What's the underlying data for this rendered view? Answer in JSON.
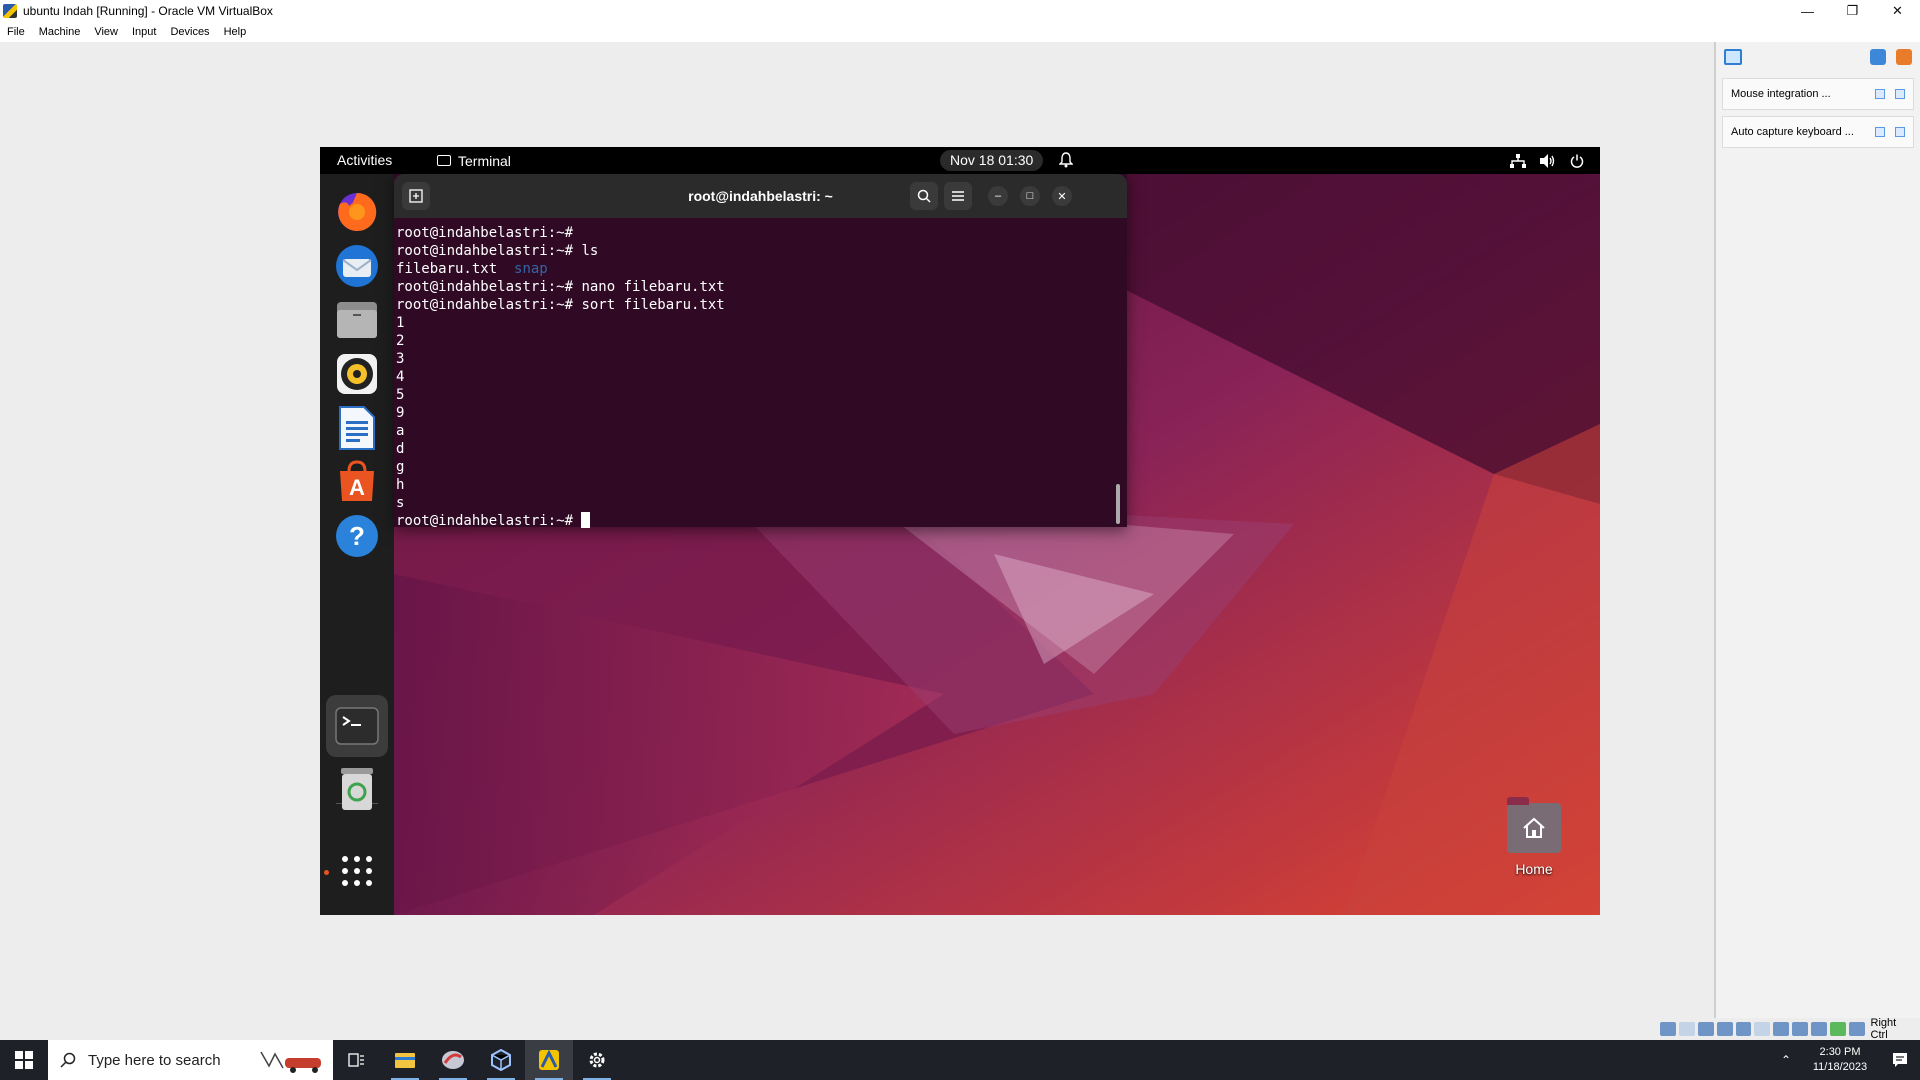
{
  "host_window": {
    "title": "ubuntu Indah [Running] - Oracle VM VirtualBox",
    "menu": [
      "File",
      "Machine",
      "View",
      "Input",
      "Devices",
      "Help"
    ]
  },
  "notifications": [
    {
      "text": "Mouse integration ..."
    },
    {
      "text": "Auto capture keyboard ..."
    }
  ],
  "status_bar": {
    "host_key": "Right Ctrl"
  },
  "guest": {
    "topbar": {
      "activities": "Activities",
      "app_name": "Terminal",
      "clock": "Nov 18  01:30"
    },
    "dock_items": [
      "firefox-icon",
      "thunderbird-icon",
      "files-icon",
      "rhythmbox-icon",
      "libreoffice-writer-icon",
      "ubuntu-software-icon",
      "help-icon",
      "terminal-icon",
      "trash-icon",
      "show-apps-icon"
    ],
    "terminal": {
      "title": "root@indahbelastri: ~",
      "lines": [
        {
          "prompt": "root@indahbelastri:~#",
          "cmd": ""
        },
        {
          "prompt": "root@indahbelastri:~#",
          "cmd": " ls"
        },
        {
          "file": "filebaru.txt",
          "dir": "snap"
        },
        {
          "prompt": "root@indahbelastri:~#",
          "cmd": " nano filebaru.txt"
        },
        {
          "prompt": "root@indahbelastri:~#",
          "cmd": " sort filebaru.txt"
        },
        {
          "out": "1"
        },
        {
          "out": "2"
        },
        {
          "out": "3"
        },
        {
          "out": "4"
        },
        {
          "out": "5"
        },
        {
          "out": "9"
        },
        {
          "out": "a"
        },
        {
          "out": "d"
        },
        {
          "out": "g"
        },
        {
          "out": "h"
        },
        {
          "out": "s"
        },
        {
          "prompt": "root@indahbelastri:~#",
          "cmd": " ",
          "cursor": true
        }
      ],
      "text_color": "#ffffff",
      "dir_color": "#3465a4",
      "background": "#300a24"
    },
    "desktop_icon": {
      "label": "Home"
    }
  },
  "taskbar": {
    "search_placeholder": "Type here to search",
    "time": "2:30 PM",
    "date": "11/18/2023"
  }
}
